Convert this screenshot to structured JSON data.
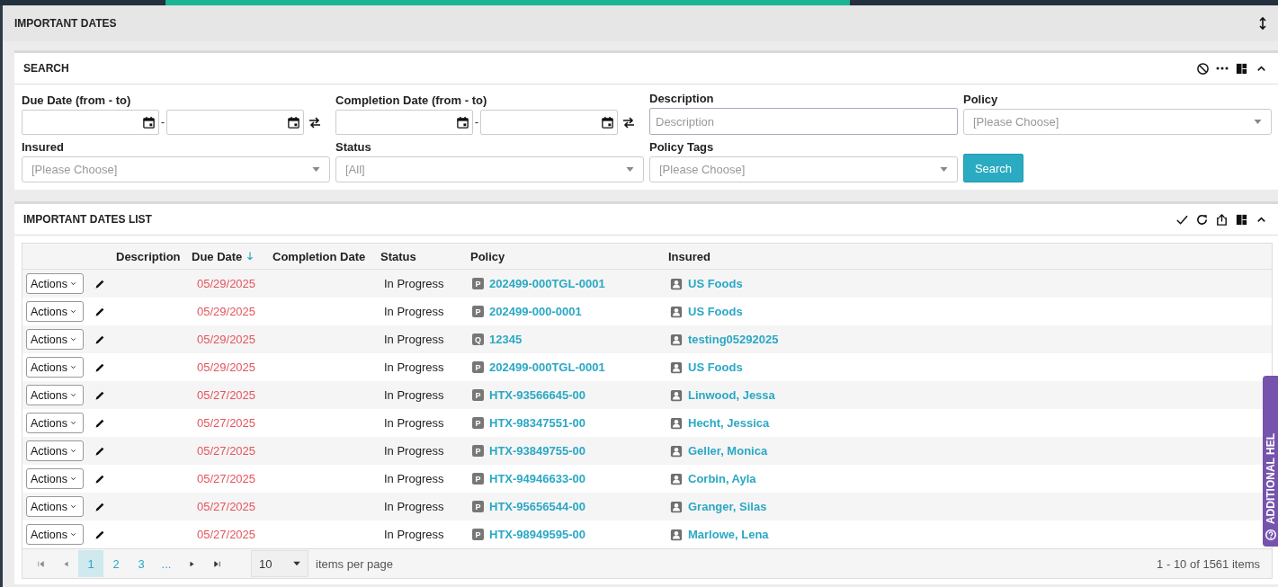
{
  "page_title": "IMPORTANT DATES",
  "search": {
    "title": "SEARCH",
    "fields": [
      {
        "kind": "daterange",
        "label": "Due Date (from - to)",
        "separator": "-"
      },
      {
        "kind": "daterange",
        "label": "Completion Date (from - to)",
        "separator": "-"
      },
      {
        "kind": "text",
        "label": "Description",
        "placeholder": "Description"
      },
      {
        "kind": "select",
        "label": "Policy",
        "placeholder": "[Please Choose]"
      },
      {
        "kind": "select",
        "label": "Insured",
        "placeholder": "[Please Choose]"
      },
      {
        "kind": "select",
        "label": "Status",
        "placeholder": "[All]"
      },
      {
        "kind": "select",
        "label": "Policy Tags",
        "placeholder": "[Please Choose]"
      },
      {
        "kind": "button",
        "label": "Search"
      }
    ]
  },
  "list": {
    "title": "IMPORTANT DATES LIST",
    "columns": [
      {
        "label": "Description",
        "sorted": false
      },
      {
        "label": "Due Date",
        "sorted": true
      },
      {
        "label": "Completion Date",
        "sorted": false
      },
      {
        "label": "Status",
        "sorted": false
      },
      {
        "label": "Policy",
        "sorted": false
      },
      {
        "label": "Insured",
        "sorted": false
      }
    ],
    "rows": [
      {
        "action": "Actions",
        "due_date": "05/29/2025",
        "status": "In Progress",
        "policy_badge": "P",
        "policy": "202499-000TGL-0001",
        "insured": "US Foods"
      },
      {
        "action": "Actions",
        "due_date": "05/29/2025",
        "status": "In Progress",
        "policy_badge": "P",
        "policy": "202499-000-0001",
        "insured": "US Foods"
      },
      {
        "action": "Actions",
        "due_date": "05/29/2025",
        "status": "In Progress",
        "policy_badge": "Q",
        "policy": "12345",
        "insured": "testing05292025"
      },
      {
        "action": "Actions",
        "due_date": "05/29/2025",
        "status": "In Progress",
        "policy_badge": "P",
        "policy": "202499-000TGL-0001",
        "insured": "US Foods"
      },
      {
        "action": "Actions",
        "due_date": "05/27/2025",
        "status": "In Progress",
        "policy_badge": "P",
        "policy": "HTX-93566645-00",
        "insured": "Linwood, Jessa"
      },
      {
        "action": "Actions",
        "due_date": "05/27/2025",
        "status": "In Progress",
        "policy_badge": "P",
        "policy": "HTX-98347551-00",
        "insured": "Hecht, Jessica"
      },
      {
        "action": "Actions",
        "due_date": "05/27/2025",
        "status": "In Progress",
        "policy_badge": "P",
        "policy": "HTX-93849755-00",
        "insured": "Geller, Monica"
      },
      {
        "action": "Actions",
        "due_date": "05/27/2025",
        "status": "In Progress",
        "policy_badge": "P",
        "policy": "HTX-94946633-00",
        "insured": "Corbin, Ayla"
      },
      {
        "action": "Actions",
        "due_date": "05/27/2025",
        "status": "In Progress",
        "policy_badge": "P",
        "policy": "HTX-95656544-00",
        "insured": "Granger, Silas"
      },
      {
        "action": "Actions",
        "due_date": "05/27/2025",
        "status": "In Progress",
        "policy_badge": "P",
        "policy": "HTX-98949595-00",
        "insured": "Marlowe, Lena"
      }
    ],
    "pager": {
      "pages": [
        {
          "label": "1",
          "selected": true
        },
        {
          "label": "2",
          "selected": false
        },
        {
          "label": "3",
          "selected": false
        },
        {
          "label": "...",
          "selected": false
        }
      ],
      "page_size": "10",
      "page_size_label": "items per page",
      "summary": "1 - 10 of 1561 items"
    }
  },
  "help_tab": {
    "label": "ADDITIONAL HEL"
  }
}
